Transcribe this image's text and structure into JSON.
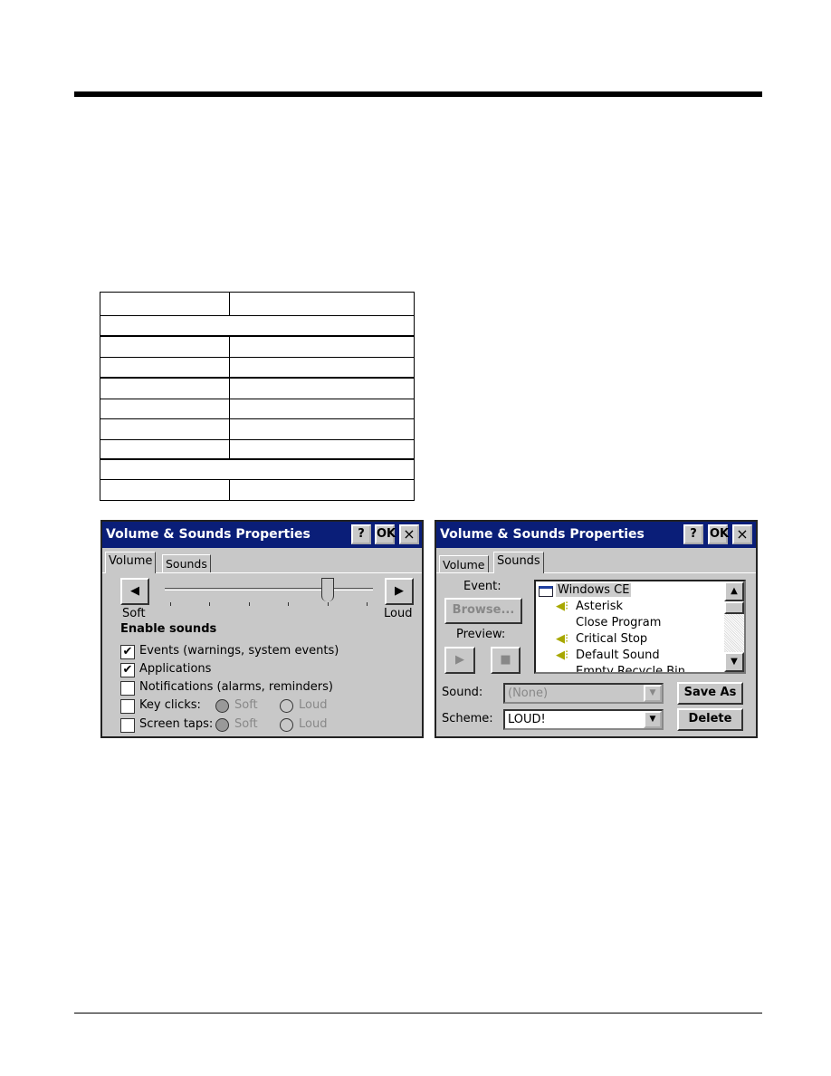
{
  "page": {
    "table": {
      "rows": 10,
      "cells": "empty"
    }
  },
  "dialog_volume": {
    "title": "Volume & Sounds Properties",
    "help": "?",
    "ok": "OK",
    "close": "×",
    "tabs": [
      "Volume",
      "Sounds"
    ],
    "active_tab": "Volume",
    "left_arrow": "◀",
    "right_arrow": "▶",
    "slider": {
      "positions": 6,
      "value_index": 4,
      "soft_label": "Soft",
      "loud_label": "Loud"
    },
    "enable_heading": "Enable sounds",
    "checks": [
      {
        "label": "Events (warnings, system events)",
        "checked": true
      },
      {
        "label": "Applications",
        "checked": true
      },
      {
        "label": "Notifications (alarms, reminders)",
        "checked": false
      },
      {
        "label": "Key clicks:",
        "checked": false
      },
      {
        "label": "Screen taps:",
        "checked": false
      }
    ],
    "radio_soft": "Soft",
    "radio_loud": "Loud",
    "check_mark": "✔"
  },
  "dialog_sounds": {
    "title": "Volume & Sounds Properties",
    "help": "?",
    "ok": "OK",
    "close": "×",
    "tabs": [
      "Volume",
      "Sounds"
    ],
    "active_tab": "Sounds",
    "event_label": "Event:",
    "browse": "Browse...",
    "preview_label": "Preview:",
    "play": "▶",
    "stop": "■",
    "events": [
      "Windows CE",
      "Asterisk",
      "Close Program",
      "Critical Stop",
      "Default Sound",
      "Empty Recycle Bin"
    ],
    "sound_label": "Sound:",
    "sound_value": "(None)",
    "scheme_label": "Scheme:",
    "scheme_value": "LOUD!",
    "save_as": "Save As",
    "delete": "Delete",
    "scroll_up": "▲",
    "scroll_down": "▼",
    "combo_arrow": "▼"
  },
  "colors": {
    "titlebar": "#0a1e78",
    "dialog_bg": "#c8c8c8",
    "speaker": "#a8a800"
  }
}
